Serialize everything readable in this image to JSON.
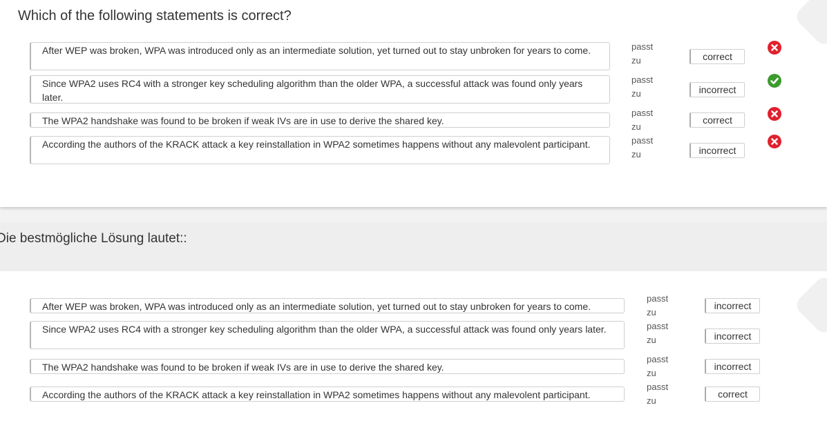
{
  "question": {
    "title": "Which of the following statements is correct?",
    "rows": [
      {
        "statement": "After WEP was broken, WPA was introduced only as an intermediate solution, yet turned out to stay unbroken for years to come.",
        "passt": "passt\nzu",
        "answer": "correct",
        "status": "x-circle-icon"
      },
      {
        "statement": "Since WPA2 uses RC4 with a stronger key scheduling algorithm than the older WPA, a successful attack was found only years later.",
        "passt": "passt\nzu",
        "answer": "incorrect",
        "status": "check-circle-icon"
      },
      {
        "statement": "The WPA2 handshake was found to be broken if weak IVs are in use to derive the shared key.",
        "passt": "passt\nzu",
        "answer": "correct",
        "status": "x-circle-icon"
      },
      {
        "statement": "According the authors of the KRACK attack a key reinstallation in WPA2 sometimes happens without any malevolent participant.",
        "passt": "passt\nzu",
        "answer": "incorrect",
        "status": "x-circle-icon"
      }
    ]
  },
  "solution": {
    "heading": "Die bestmögliche Lösung lautet::",
    "rows": [
      {
        "statement": "After WEP was broken, WPA was introduced only as an intermediate solution, yet turned out to stay unbroken for years to come.",
        "passt": "passt\nzu",
        "answer": "incorrect"
      },
      {
        "statement": "Since WPA2 uses RC4 with a stronger key scheduling algorithm than the older WPA, a successful attack was found only years later.",
        "passt": "passt\nzu",
        "answer": "incorrect"
      },
      {
        "statement": "The WPA2 handshake was found to be broken if weak IVs are in use to derive the shared key.",
        "passt": "passt\nzu",
        "answer": "incorrect"
      },
      {
        "statement": "According the authors of the KRACK attack a key reinstallation in WPA2 sometimes happens without any malevolent participant.",
        "passt": "passt\nzu",
        "answer": "correct"
      }
    ]
  },
  "colors": {
    "wrong": "#e0212e",
    "right": "#3d9a2e"
  }
}
